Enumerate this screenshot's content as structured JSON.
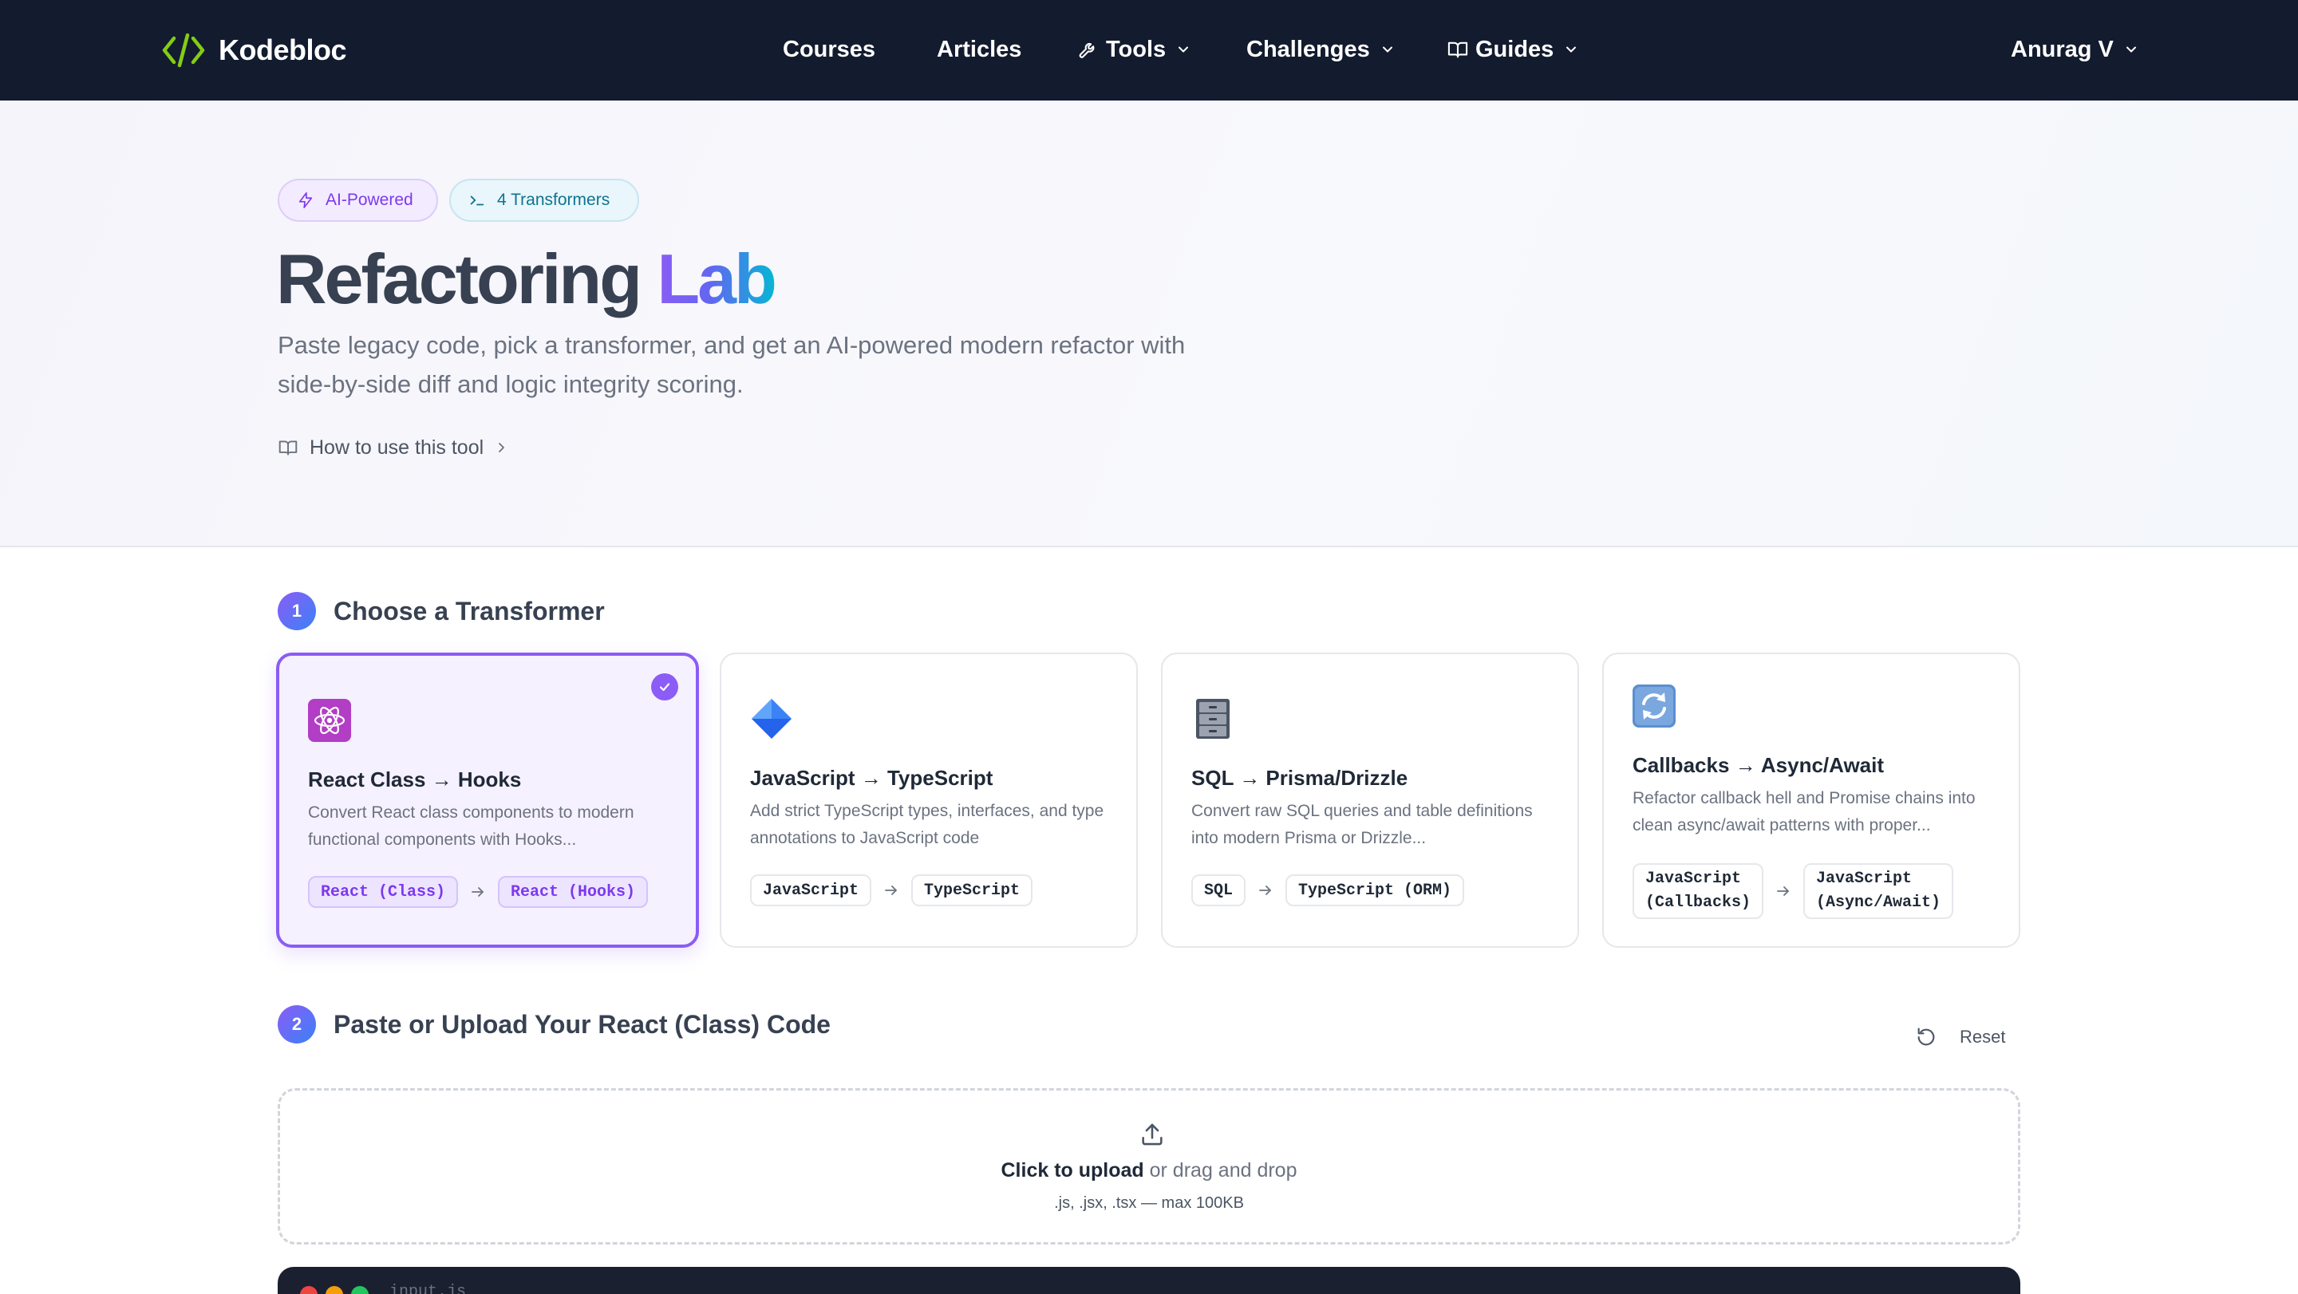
{
  "nav": {
    "brand": "Kodebloc",
    "items": [
      {
        "label": "Courses"
      },
      {
        "label": "Articles"
      },
      {
        "label": "Tools"
      },
      {
        "label": "Challenges"
      },
      {
        "label": "Guides"
      }
    ],
    "user": "Anurag V"
  },
  "hero": {
    "badges": [
      {
        "label": "AI-Powered",
        "icon": "bolt-icon"
      },
      {
        "label": "4 Transformers",
        "icon": "terminal-icon"
      }
    ],
    "title_main": "Refactoring ",
    "title_accent": "Lab",
    "description": "Paste legacy code, pick a transformer, and get an AI-powered modern refactor with side-by-side diff and logic integrity scoring.",
    "how_to": "How to use this tool"
  },
  "step1": {
    "number": "1",
    "title": "Choose a Transformer"
  },
  "transformers": [
    {
      "icon": "atom-icon",
      "title": "React Class → Hooks",
      "description": "Convert React class components to modern functional components with Hooks...",
      "from": "React (Class)",
      "to": "React (Hooks)",
      "selected": true
    },
    {
      "icon": "diamond-icon",
      "title": "JavaScript → TypeScript",
      "description": "Add strict TypeScript types, interfaces, and type annotations to JavaScript code",
      "from": "JavaScript",
      "to": "TypeScript",
      "selected": false
    },
    {
      "icon": "cabinet-icon",
      "title": "SQL → Prisma/Drizzle",
      "description": "Convert raw SQL queries and table definitions into modern Prisma or Drizzle...",
      "from": "SQL",
      "to": "TypeScript (ORM)",
      "selected": false
    },
    {
      "icon": "refresh-icon",
      "title": "Callbacks → Async/Await",
      "description": "Refactor callback hell and Promise chains into clean async/await patterns with proper...",
      "from": "JavaScript\n(Callbacks)",
      "to": "JavaScript\n(Async/Await)",
      "selected": false
    }
  ],
  "step2": {
    "number": "2",
    "title": "Paste or Upload Your React (Class) Code",
    "reset": "Reset"
  },
  "upload": {
    "action": "Click to upload",
    "rest": " or drag and drop",
    "hint": ".js, .jsx, .tsx — max 100KB"
  },
  "editor": {
    "filename": "input.js"
  },
  "colors": {
    "nav_bg": "#131b2e",
    "accent": "#8b5cf6",
    "logo_green": "#84cc16"
  }
}
